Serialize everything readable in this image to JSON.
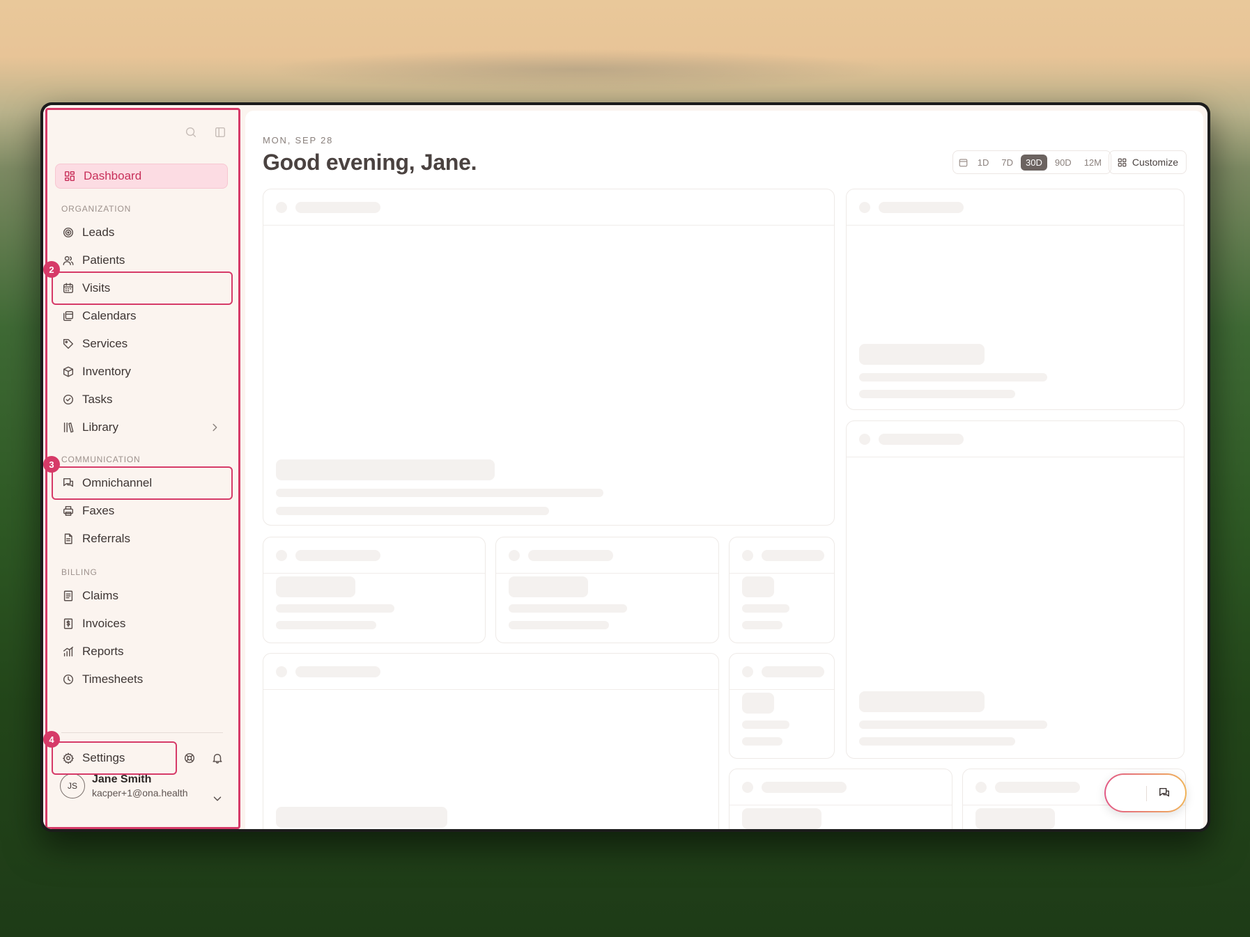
{
  "sidebar": {
    "active_item": "Dashboard",
    "sections": {
      "organization": "ORGANIZATION",
      "communication": "COMMUNICATION",
      "billing": "BILLING"
    },
    "items": {
      "leads": "Leads",
      "patients": "Patients",
      "visits": "Visits",
      "calendars": "Calendars",
      "services": "Services",
      "inventory": "Inventory",
      "tasks": "Tasks",
      "library": "Library",
      "omnichannel": "Omnichannel",
      "faxes": "Faxes",
      "referrals": "Referrals",
      "claims": "Claims",
      "invoices": "Invoices",
      "reports": "Reports",
      "timesheets": "Timesheets"
    },
    "settings": "Settings",
    "user": {
      "initials": "JS",
      "name": "Jane Smith",
      "email": "kacper+1@ona.health"
    }
  },
  "annotations": {
    "badge_2": "2",
    "badge_3": "3",
    "badge_4": "4"
  },
  "main": {
    "date": "MON, SEP 28",
    "greeting": "Good evening, Jane.",
    "range_options": [
      "1D",
      "7D",
      "30D",
      "90D",
      "12M"
    ],
    "range_selected": "30D",
    "customize_label": "Customize"
  },
  "colors": {
    "accent": "#d63a68",
    "active_bg": "#fcdce3",
    "sidebar_bg": "#fbf4ef"
  }
}
